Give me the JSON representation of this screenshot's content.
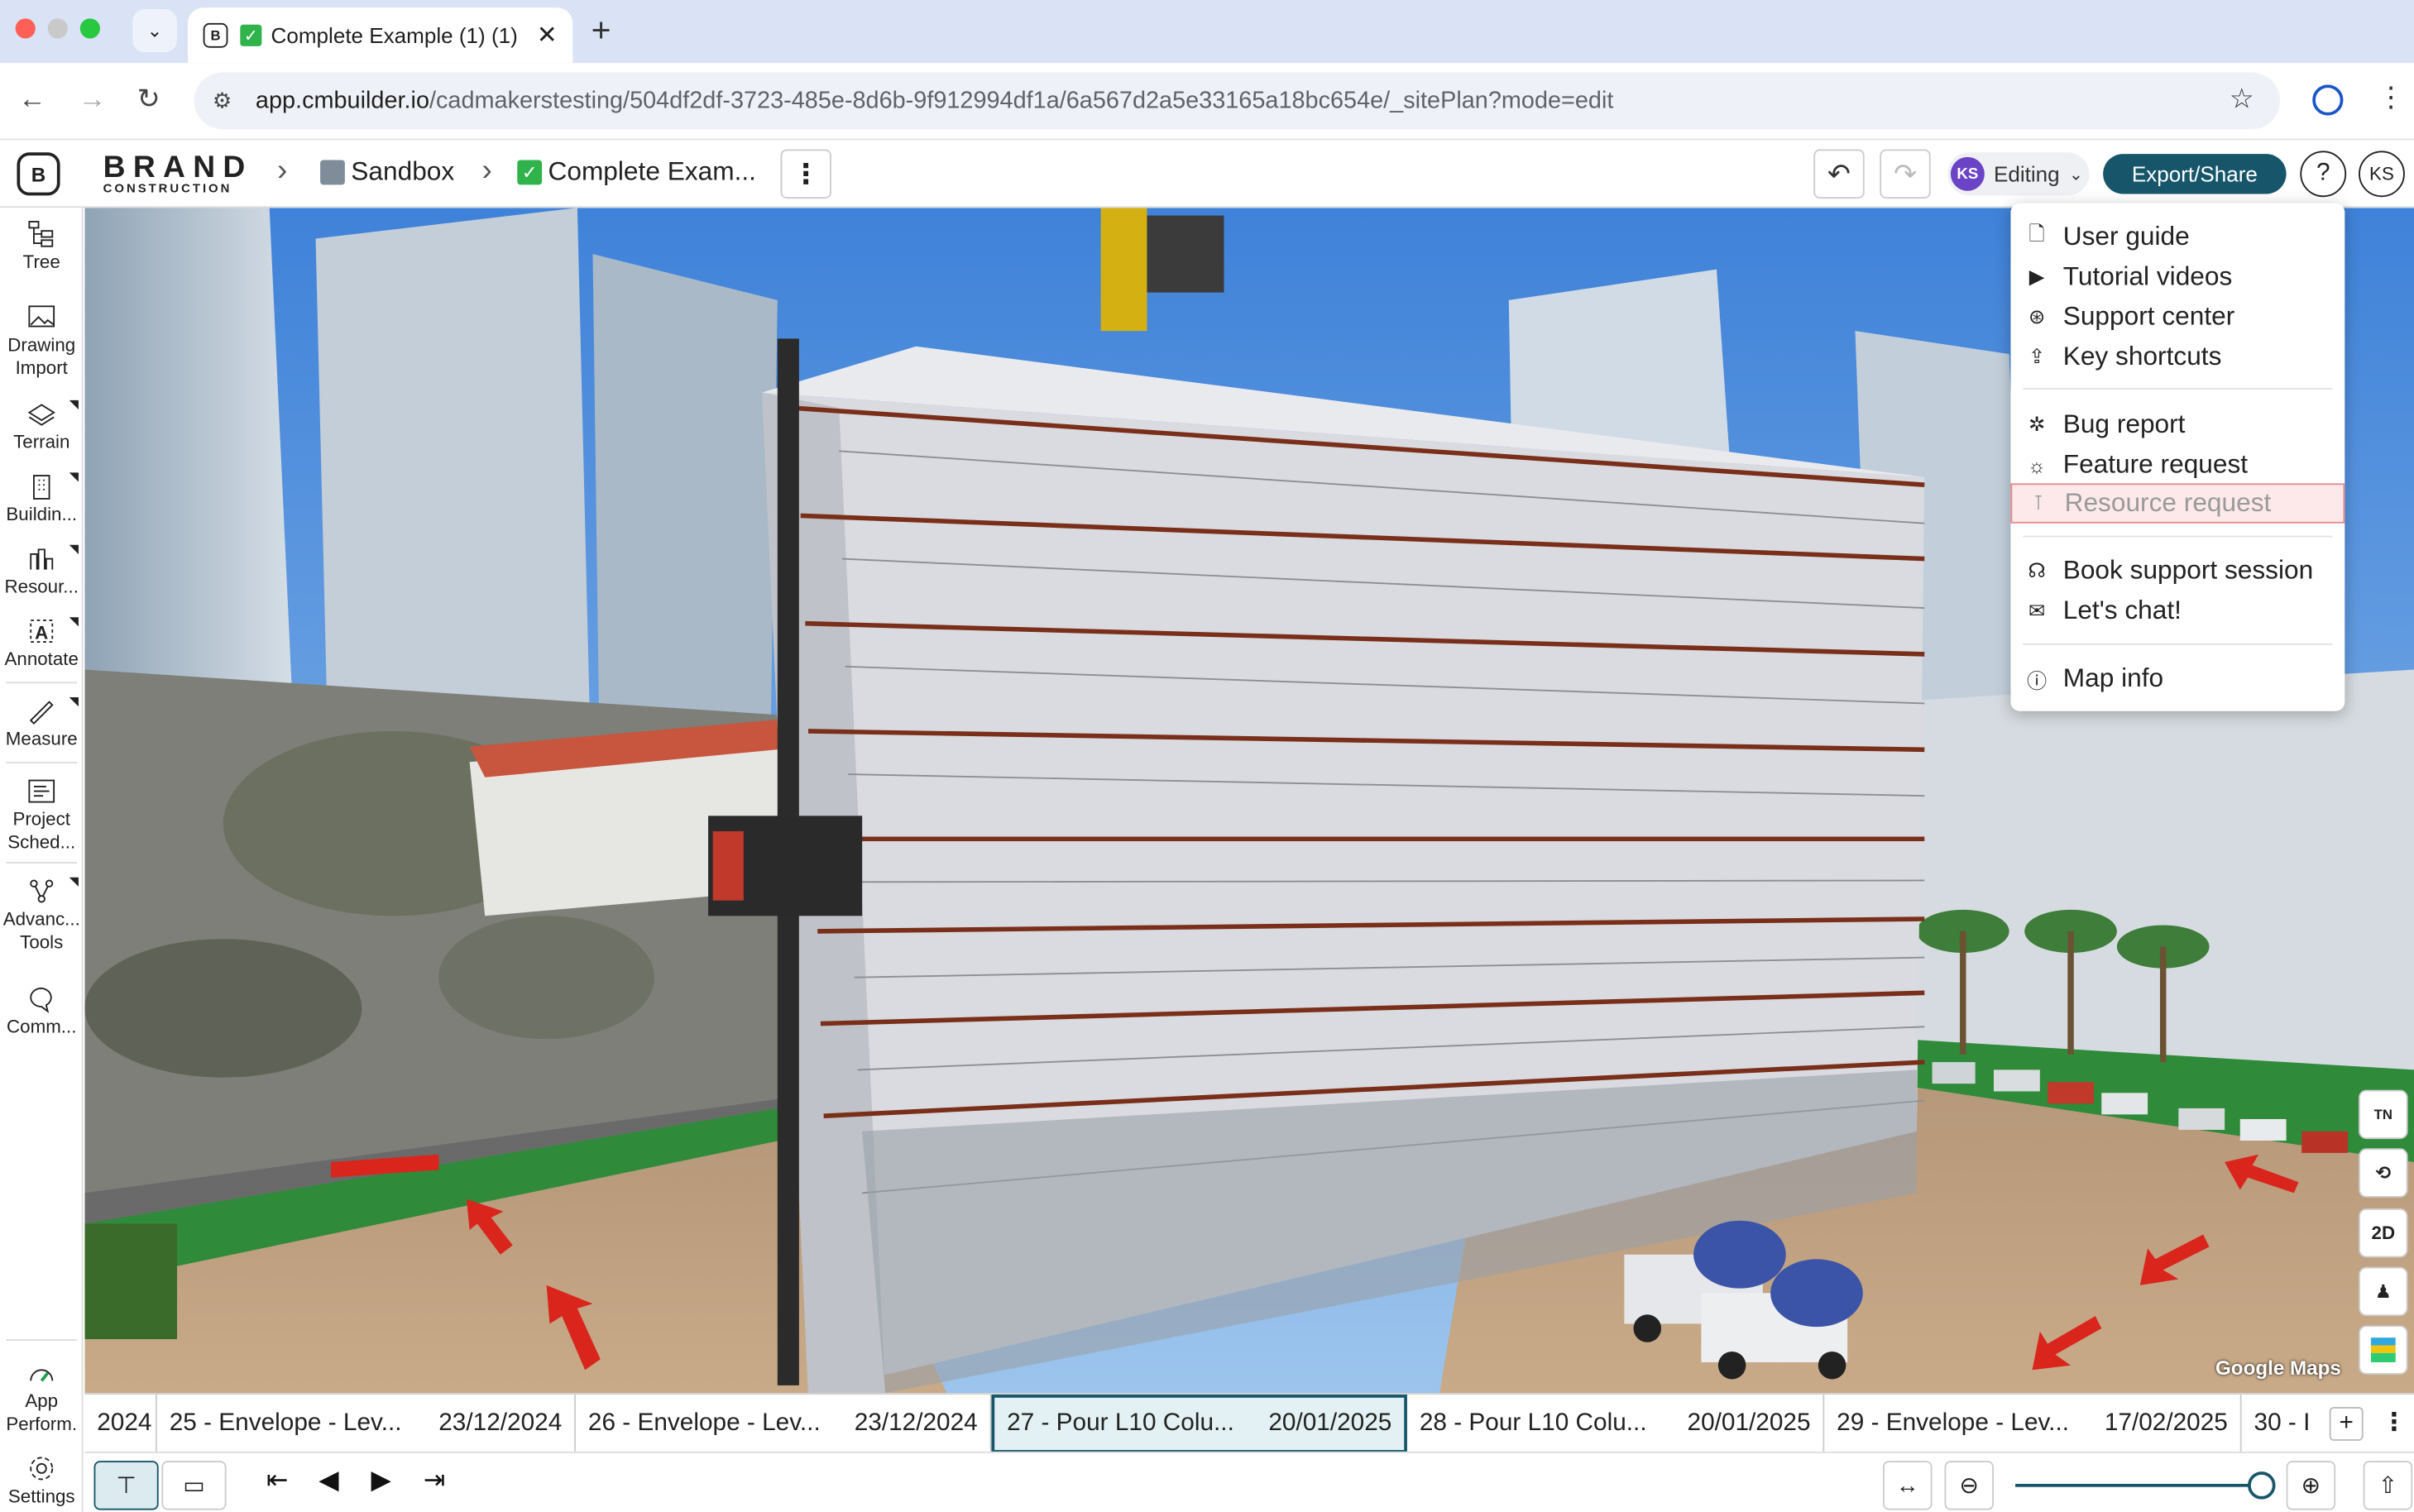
{
  "browser": {
    "tab_title": "Complete Example (1) (1)",
    "url_host": "app.cmbuilder.io",
    "url_path": "/cadmakerstesting/504df2df-3723-485e-8d6b-9f912994df1a/6a567d2a5e33165a18bc654e/_sitePlan?mode=edit"
  },
  "header": {
    "brand_name": "BRAND",
    "brand_sub": "CONSTRUCTION",
    "crumb_project": "Sandbox",
    "crumb_model": "Complete Exam...",
    "editing_avatar": "KS",
    "editing_label": "Editing",
    "export_label": "Export/Share",
    "help_label": "?",
    "user_initials": "KS"
  },
  "toolbar": {
    "tree": "Tree",
    "drawing_import_1": "Drawing",
    "drawing_import_2": "Import",
    "terrain": "Terrain",
    "buildings": "Buildin...",
    "resources": "Resour...",
    "annotate": "Annotate",
    "measure": "Measure",
    "project_sched_1": "Project",
    "project_sched_2": "Sched...",
    "advanced_1": "Advanc...",
    "advanced_2": "Tools",
    "comments": "Comm...",
    "app_perf_1": "App",
    "app_perf_2": "Perform.",
    "settings": "Settings"
  },
  "help_menu": {
    "items": [
      {
        "label": "User guide",
        "icon": "document-icon"
      },
      {
        "label": "Tutorial videos",
        "icon": "play-icon"
      },
      {
        "label": "Support center",
        "icon": "support-icon"
      },
      {
        "label": "Key shortcuts",
        "icon": "keyboard-icon"
      },
      {
        "label": "Bug report",
        "icon": "bug-icon"
      },
      {
        "label": "Feature request",
        "icon": "lightbulb-icon"
      },
      {
        "label": "Resource request",
        "icon": "crane-icon"
      },
      {
        "label": "Book support session",
        "icon": "headset-icon"
      },
      {
        "label": "Let's chat!",
        "icon": "chat-icon"
      },
      {
        "label": "Map info",
        "icon": "info-icon"
      }
    ]
  },
  "viewport": {
    "attribution": "Google Maps",
    "controls": [
      "TN",
      "2D"
    ]
  },
  "timeline": {
    "items": [
      {
        "label": "",
        "date": "2024"
      },
      {
        "label": "25 - Envelope - Lev...",
        "date": "23/12/2024"
      },
      {
        "label": "26 - Envelope - Lev...",
        "date": "23/12/2024"
      },
      {
        "label": "27 - Pour L10 Colu...",
        "date": "20/01/2025"
      },
      {
        "label": "28 - Pour L10 Colu...",
        "date": "20/01/2025"
      },
      {
        "label": "29 - Envelope - Lev...",
        "date": "17/02/2025"
      },
      {
        "label": "30 - I",
        "date": ""
      }
    ],
    "active_index": 3
  },
  "colors": {
    "accent": "#17566a",
    "editing_avatar": "#6b43c6",
    "disabled_highlight": "#fde9ea"
  }
}
